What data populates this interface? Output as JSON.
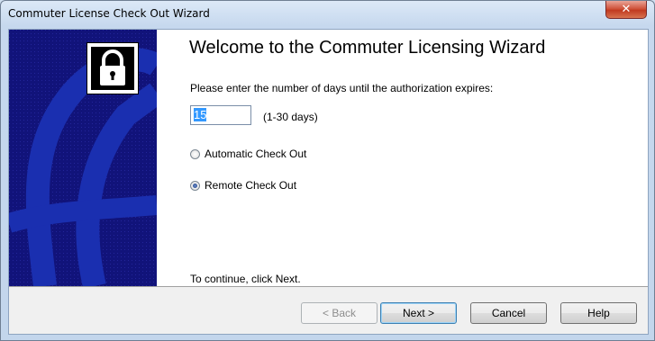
{
  "window": {
    "title": "Commuter License Check Out Wizard",
    "close_glyph": "✕"
  },
  "banner": {
    "icon": "padlock-icon",
    "background": "#11137a"
  },
  "content": {
    "heading": "Welcome to the Commuter Licensing Wizard",
    "prompt": "Please enter the number of days until the authorization expires:",
    "days_value": "15",
    "days_range": "(1-30 days)",
    "options": [
      {
        "label": "Automatic Check Out",
        "checked": false
      },
      {
        "label": "Remote Check Out",
        "checked": true
      }
    ],
    "continue_text": "To continue, click Next."
  },
  "buttons": {
    "back": "< Back",
    "next": "Next >",
    "cancel": "Cancel",
    "help": "Help"
  }
}
